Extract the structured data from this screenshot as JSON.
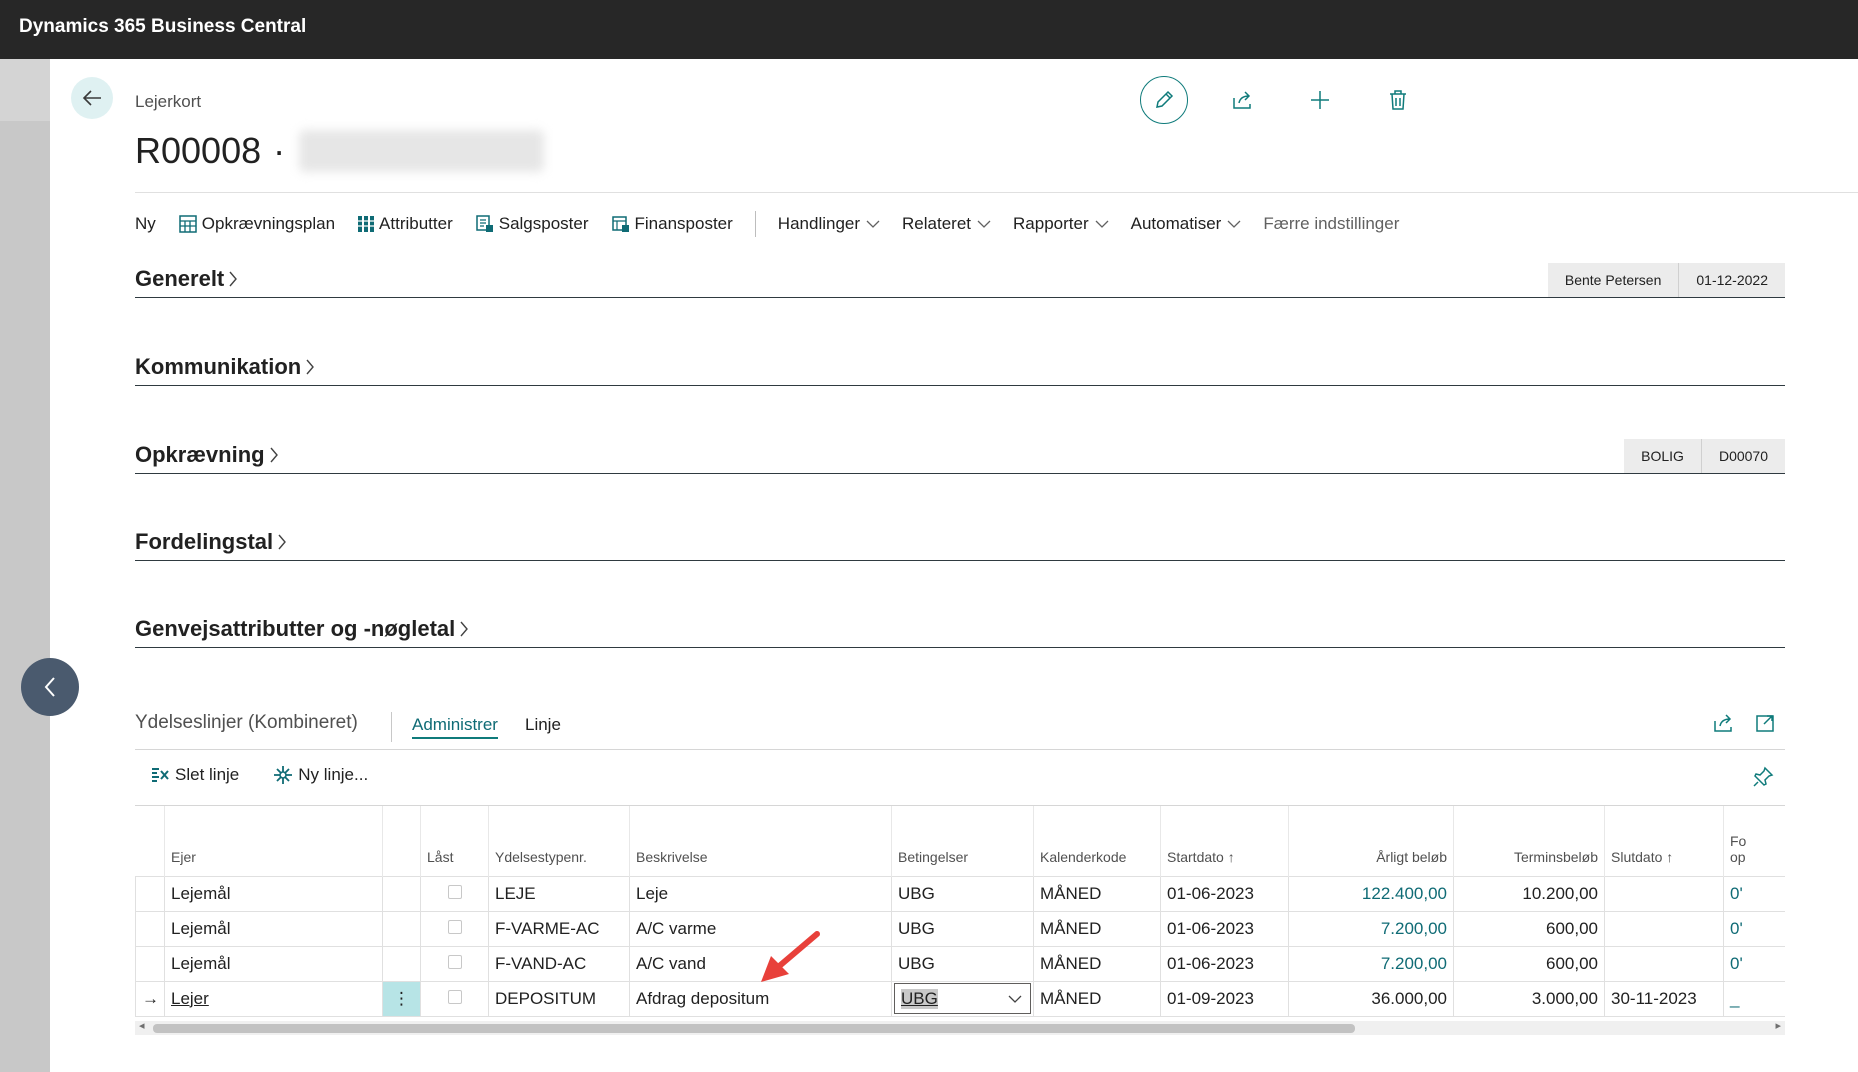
{
  "app": {
    "title": "Dynamics 365 Business Central"
  },
  "header": {
    "breadcrumb": "Lejerkort",
    "record_id": "R00008",
    "record_sep": "·"
  },
  "header_actions": {
    "edit": "pencil-icon",
    "share": "share-icon",
    "new": "plus-icon",
    "delete": "trash-icon"
  },
  "actionbar": {
    "items": [
      {
        "label": "Ny"
      },
      {
        "label": "Opkrævningsplan"
      },
      {
        "label": "Attributter"
      },
      {
        "label": "Salgsposter"
      },
      {
        "label": "Finansposter"
      },
      {
        "label": "Handlinger"
      },
      {
        "label": "Relateret"
      },
      {
        "label": "Rapporter"
      },
      {
        "label": "Automatiser"
      },
      {
        "label": "Færre indstillinger"
      }
    ]
  },
  "fasttabs": {
    "generelt": {
      "title": "Generelt",
      "summary": [
        "Bente Petersen",
        "01-12-2022"
      ]
    },
    "kommunikation": {
      "title": "Kommunikation"
    },
    "opkraevning": {
      "title": "Opkrævning",
      "summary": [
        "BOLIG",
        "D00070"
      ]
    },
    "fordelingstal": {
      "title": "Fordelingstal"
    },
    "genvej": {
      "title": "Genvejsattributter og -nøgletal"
    }
  },
  "part": {
    "title": "Ydelseslinjer (Kombineret)",
    "tabs": [
      "Administrer",
      "Linje"
    ],
    "actions": {
      "delete": "Slet linje",
      "new": "Ny linje..."
    }
  },
  "grid": {
    "columns": {
      "ejer": "Ejer",
      "laast": "Låst",
      "ydelsestype": "Ydelsestypenr.",
      "beskrivelse": "Beskrivelse",
      "betingelser": "Betingelser",
      "kalenderkode": "Kalenderkode",
      "startdato": "Startdato",
      "aarligt": "Årligt beløb",
      "termin": "Terminsbeløb",
      "slutdato": "Slutdato",
      "fo_1": "Fo",
      "fo_2": "op"
    },
    "rows": [
      {
        "ejer": "Lejemål",
        "ydelsestype": "LEJE",
        "beskrivelse": "Leje",
        "betingelser": "UBG",
        "kalenderkode": "MÅNED",
        "startdato": "01-06-2023",
        "aarligt": "122.400,00",
        "termin": "10.200,00",
        "slutdato": "",
        "fo": "0'"
      },
      {
        "ejer": "Lejemål",
        "ydelsestype": "F-VARME-AC",
        "beskrivelse": "A/C varme",
        "betingelser": "UBG",
        "kalenderkode": "MÅNED",
        "startdato": "01-06-2023",
        "aarligt": "7.200,00",
        "termin": "600,00",
        "slutdato": "",
        "fo": "0'"
      },
      {
        "ejer": "Lejemål",
        "ydelsestype": "F-VAND-AC",
        "beskrivelse": "A/C vand",
        "betingelser": "UBG",
        "kalenderkode": "MÅNED",
        "startdato": "01-06-2023",
        "aarligt": "7.200,00",
        "termin": "600,00",
        "slutdato": "",
        "fo": "0'"
      },
      {
        "ejer": "Lejer",
        "ydelsestype": "DEPOSITUM",
        "beskrivelse": "Afdrag depositum",
        "betingelser": "UBG",
        "kalenderkode": "MÅNED",
        "startdato": "01-09-2023",
        "aarligt": "36.000,00",
        "termin": "3.000,00",
        "slutdato": "30-11-2023",
        "fo": "_"
      }
    ],
    "row_menu": "⋮",
    "current_row_marker": "→"
  },
  "colors": {
    "accent": "#0f7b7b",
    "topbar": "#272727",
    "annotation": "#e8403a"
  }
}
